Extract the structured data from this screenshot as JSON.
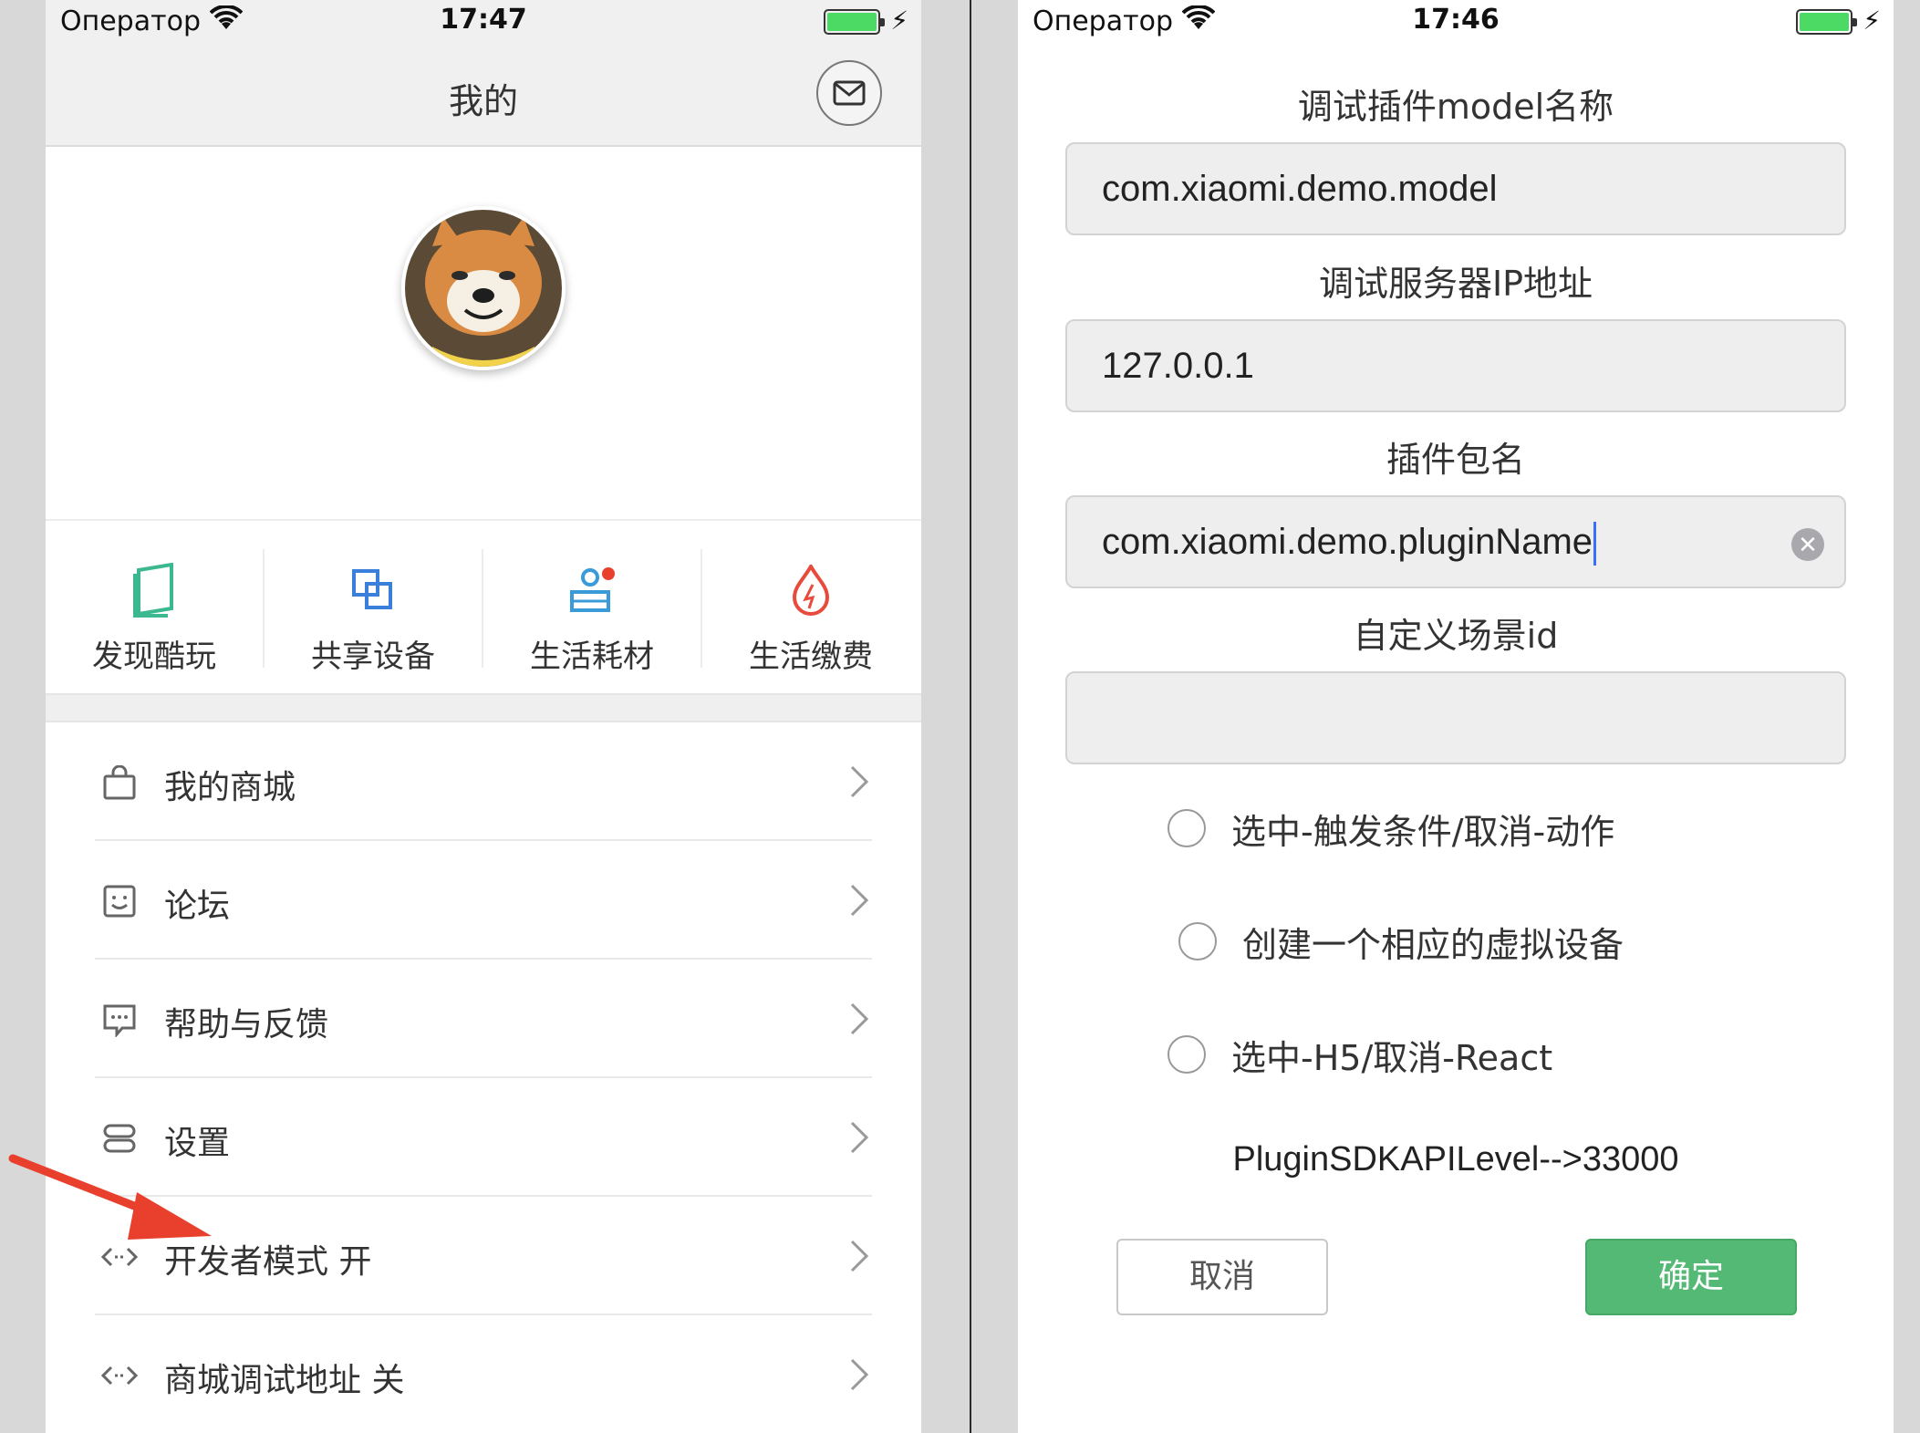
{
  "left": {
    "status": {
      "carrier": "Оператор",
      "time": "17:47"
    },
    "nav": {
      "title": "我的"
    },
    "quick_actions": [
      {
        "label": "发现酷玩",
        "icon": "book-icon",
        "color": "#3bb88f"
      },
      {
        "label": "共享设备",
        "icon": "share-devices-icon",
        "color": "#3a7fd9"
      },
      {
        "label": "生活耗材",
        "icon": "consumables-icon",
        "color": "#3a9bd9"
      },
      {
        "label": "生活缴费",
        "icon": "flame-icon",
        "color": "#e84b3c"
      }
    ],
    "menu": [
      {
        "label": "我的商城",
        "icon": "shopping-bag-icon"
      },
      {
        "label": "论坛",
        "icon": "smiley-icon"
      },
      {
        "label": "帮助与反馈",
        "icon": "chat-bubble-icon"
      },
      {
        "label": "设置",
        "icon": "settings-toggle-icon"
      },
      {
        "label": "开发者模式 开",
        "icon": "code-arrows-icon"
      },
      {
        "label": "商城调试地址 关",
        "icon": "code-arrows-icon"
      }
    ]
  },
  "right": {
    "status": {
      "carrier": "Оператор",
      "time": "17:46"
    },
    "fields": [
      {
        "label": "调试插件model名称",
        "value": "com.xiaomi.demo.model"
      },
      {
        "label": "调试服务器IP地址",
        "value": "127.0.0.1"
      },
      {
        "label": "插件包名",
        "value": "com.xiaomi.demo.pluginName"
      },
      {
        "label": "自定义场景id",
        "value": ""
      }
    ],
    "options": [
      {
        "label": "选中-触发条件/取消-动作",
        "checked": false
      },
      {
        "label": "创建一个相应的虚拟设备",
        "checked": false
      },
      {
        "label": "选中-H5/取消-React",
        "checked": false
      }
    ],
    "sdk_level": "PluginSDKAPILevel-->33000",
    "buttons": {
      "cancel": "取消",
      "ok": "确定"
    }
  },
  "colors": {
    "accent_green": "#53b974",
    "battery_green": "#4cd964",
    "annotation_red": "#e8402c"
  }
}
